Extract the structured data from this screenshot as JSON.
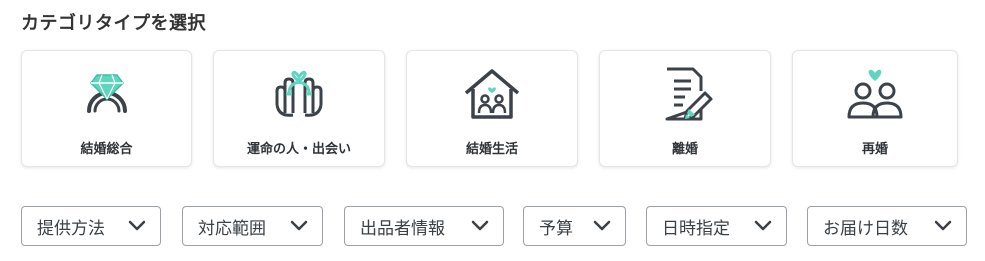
{
  "section_title": "カテゴリタイプを選択",
  "categories": [
    {
      "label": "結婚総合",
      "icon": "diamond-ring-icon"
    },
    {
      "label": "運命の人・出会い",
      "icon": "red-string-fingers-icon"
    },
    {
      "label": "結婚生活",
      "icon": "family-house-icon"
    },
    {
      "label": "離婚",
      "icon": "divorce-document-icon"
    },
    {
      "label": "再婚",
      "icon": "couple-heart-icon"
    }
  ],
  "filters": [
    {
      "label": "提供方法"
    },
    {
      "label": "対応範囲"
    },
    {
      "label": "出品者情報"
    },
    {
      "label": "予算"
    },
    {
      "label": "日時指定"
    },
    {
      "label": "お届け日数"
    }
  ],
  "colors": {
    "accent": "#5fd5c0",
    "icon_stroke": "#3b4249",
    "text": "#333333",
    "border": "#9aa1a7"
  }
}
